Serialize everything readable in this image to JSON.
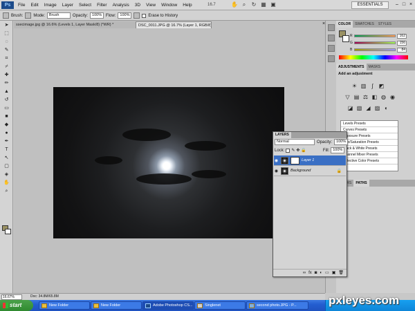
{
  "menubar": {
    "logo": "Ps",
    "items": [
      "File",
      "Edit",
      "Image",
      "Layer",
      "Select",
      "Filter",
      "Analysis",
      "3D",
      "View",
      "Window",
      "Help"
    ],
    "zoom_readout": "16.7",
    "workspace": "ESSENTIALS"
  },
  "options": {
    "brush_label": "Brush:",
    "mode_label": "Mode:",
    "mode_value": "Brush",
    "opacity_label": "Opacity:",
    "opacity_value": "100%",
    "flow_label": "Flow:",
    "flow_value": "100%",
    "erase_history_label": "Erase to History"
  },
  "tabs": [
    {
      "label": "ssecimage.jpg @ 16.6% (Levels 1, Layer Mask/8) (*WR) *"
    },
    {
      "label": "DSC_0011.JPG @ 16.7% (Layer 1, RGB/8) *"
    }
  ],
  "status": {
    "zoom": "16.67%",
    "docinfo": "Doc: 34.8M/65.8M"
  },
  "color_panel": {
    "tabs": [
      "COLOR",
      "SWATCHES",
      "STYLES"
    ],
    "fg_color": "#9a9163",
    "channels": [
      {
        "ch": "R",
        "value": "162"
      },
      {
        "ch": "G",
        "value": "156"
      },
      {
        "ch": "B",
        "value": "84"
      }
    ]
  },
  "adjustments": {
    "tabs": [
      "ADJUSTMENTS",
      "MASKS"
    ],
    "title": "Add an adjustment",
    "presets": [
      "Levels Presets",
      "Curves Presets",
      "Exposure Presets",
      "Hue/Saturation Presets",
      "Black & White Presets",
      "Channel Mixer Presets",
      "Selective Color Presets"
    ]
  },
  "lower_panel": {
    "tabs": [
      "LAYERS",
      "PATHS"
    ]
  },
  "layers_panel": {
    "tab": "LAYERS",
    "blend_mode": "Normal",
    "opacity_label": "Opacity:",
    "opacity_value": "100%",
    "lock_label": "Lock:",
    "fill_label": "Fill:",
    "fill_value": "100%",
    "layers": [
      {
        "name": "Layer 1",
        "selected": true
      },
      {
        "name": "Background",
        "selected": false
      }
    ]
  },
  "taskbar": {
    "start": "start",
    "items": [
      {
        "label": "New Folder"
      },
      {
        "label": "New Folder"
      },
      {
        "label": "Adobe Photoshop CS..."
      },
      {
        "label": "Singlenet"
      },
      {
        "label": "second photo.JPG - P..."
      }
    ]
  },
  "watermark": "pxleyes.com"
}
